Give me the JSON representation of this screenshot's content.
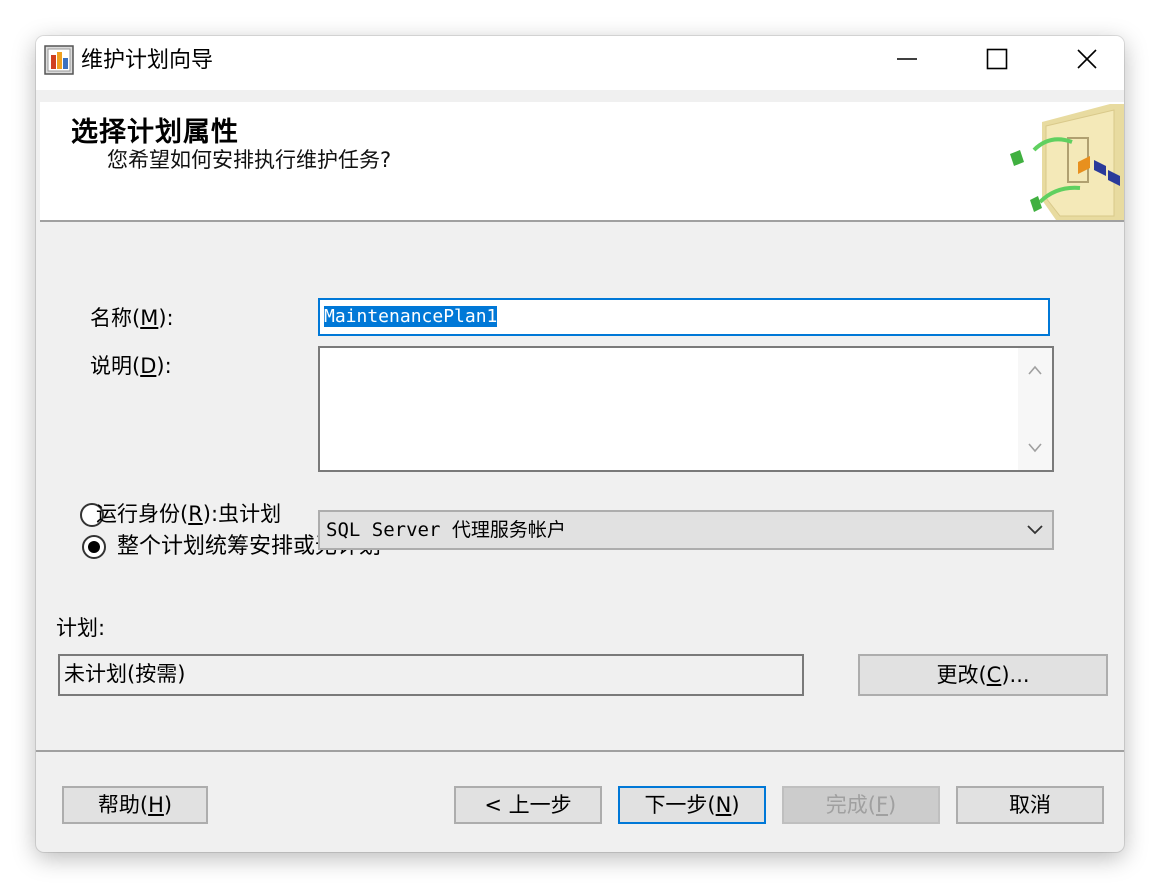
{
  "window": {
    "title": "维护计划向导",
    "icon": "maintenance-plan-icon",
    "controls": [
      "minimize-icon",
      "maximize-icon",
      "close-icon"
    ]
  },
  "header": {
    "title": "选择计划属性",
    "subtitle": "您希望如何安排执行维护任务?"
  },
  "form": {
    "name_label": "名称(",
    "name_hotkey": "M",
    "name_label_end": "):",
    "name_value": "MaintenancePlan1",
    "description_label": "说明(",
    "description_hotkey": "D",
    "description_label_end": "):",
    "description_value": "",
    "runas_label": "运行身份(",
    "runas_hotkey": "R",
    "runas_label_end": "):",
    "runas_overlap_text": "虫计划",
    "runas_value": "SQL Server 代理服务帐户",
    "radio_whole_plan_label": "整个计划统筹安排或无计划",
    "radio_whole_plan_checked": true
  },
  "schedule": {
    "label": "计划:",
    "value": "未计划(按需)",
    "change_button_label": "更改(",
    "change_button_hotkey": "C",
    "change_button_label_end": ")..."
  },
  "buttons": {
    "help_label": "帮助(",
    "help_hotkey": "H",
    "help_end": ")",
    "back_label": "< 上一步",
    "next_label": "下一步(",
    "next_hotkey": "N",
    "next_end": ")",
    "finish_label": "完成(",
    "finish_hotkey": "F",
    "finish_end": ")",
    "cancel_label": "取消"
  },
  "colors": {
    "accent": "#0078d7",
    "window_bg": "#f0f0f0",
    "button_bg": "#e1e1e1"
  }
}
